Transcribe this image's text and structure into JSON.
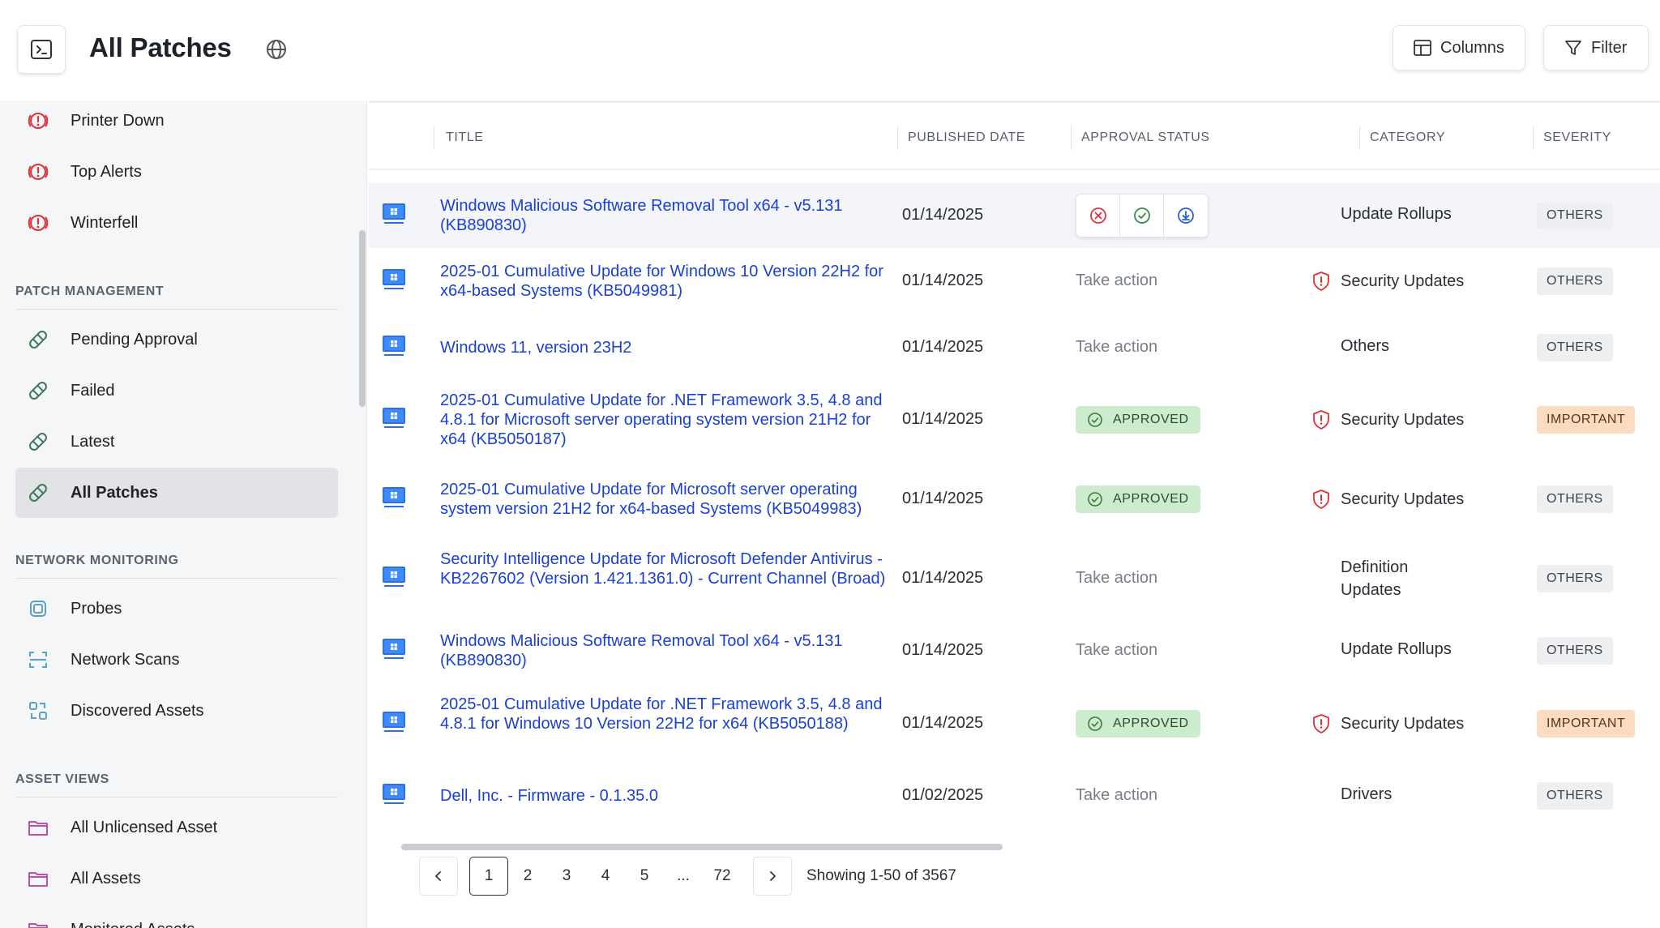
{
  "header": {
    "title": "All Patches",
    "columns_label": "Columns",
    "filter_label": "Filter"
  },
  "sidebar": {
    "alerts": [
      {
        "label": "Printer Down",
        "icon": "alert-icon"
      },
      {
        "label": "Top Alerts",
        "icon": "alert-icon"
      },
      {
        "label": "Winterfell",
        "icon": "alert-icon"
      }
    ],
    "patch_section": "PATCH MANAGEMENT",
    "patch_items": [
      {
        "label": "Pending Approval",
        "icon": "bandage-icon"
      },
      {
        "label": "Failed",
        "icon": "bandage-icon"
      },
      {
        "label": "Latest",
        "icon": "bandage-icon"
      },
      {
        "label": "All Patches",
        "icon": "bandage-icon",
        "active": true
      }
    ],
    "network_section": "NETWORK MONITORING",
    "network_items": [
      {
        "label": "Probes",
        "icon": "chip-icon"
      },
      {
        "label": "Network Scans",
        "icon": "scan-icon"
      },
      {
        "label": "Discovered Assets",
        "icon": "discover-icon"
      }
    ],
    "asset_section": "ASSET VIEWS",
    "asset_items": [
      {
        "label": "All Unlicensed Asset",
        "icon": "folder-icon"
      },
      {
        "label": "All Assets",
        "icon": "folder-icon"
      },
      {
        "label": "Monitored Assets",
        "icon": "folder-icon"
      }
    ]
  },
  "table": {
    "columns": [
      "TITLE",
      "PUBLISHED DATE",
      "APPROVAL STATUS",
      "CATEGORY",
      "SEVERITY"
    ],
    "rows": [
      {
        "title": "Windows Malicious Software Removal Tool x64 - v5.131 (KB890830)",
        "date": "01/14/2025",
        "status": "actions",
        "category": "Update Rollups",
        "security": false,
        "severity": "OTHERS"
      },
      {
        "title": "2025-01 Cumulative Update for Windows 10 Version 22H2 for x64-based Systems (KB5049981)",
        "date": "01/14/2025",
        "status": "Take action",
        "category": "Security Updates",
        "security": true,
        "severity": "OTHERS"
      },
      {
        "title": "Windows 11, version 23H2",
        "date": "01/14/2025",
        "status": "Take action",
        "category": "Others",
        "security": false,
        "severity": "OTHERS"
      },
      {
        "title": "2025-01 Cumulative Update for .NET Framework 3.5, 4.8 and 4.8.1 for Microsoft server operating system version 21H2 for x64 (KB5050187)",
        "date": "01/14/2025",
        "status": "APPROVED",
        "category": "Security Updates",
        "security": true,
        "severity": "IMPORTANT"
      },
      {
        "title": "2025-01 Cumulative Update for Microsoft server operating system version 21H2 for x64-based Systems (KB5049983)",
        "date": "01/14/2025",
        "status": "APPROVED",
        "category": "Security Updates",
        "security": true,
        "severity": "OTHERS"
      },
      {
        "title": "Security Intelligence Update for Microsoft Defender Antivirus - KB2267602 (Version 1.421.1361.0) - Current Channel (Broad)",
        "date": "01/14/2025",
        "status": "Take action",
        "category": "Definition Updates",
        "security": false,
        "severity": "OTHERS"
      },
      {
        "title": "Windows Malicious Software Removal Tool x64 - v5.131 (KB890830)",
        "date": "01/14/2025",
        "status": "Take action",
        "category": "Update Rollups",
        "security": false,
        "severity": "OTHERS"
      },
      {
        "title": "2025-01 Cumulative Update for .NET Framework 3.5, 4.8 and 4.8.1 for Windows 10 Version 22H2 for x64 (KB5050188)",
        "date": "01/14/2025",
        "status": "APPROVED",
        "category": "Security Updates",
        "security": true,
        "severity": "IMPORTANT"
      },
      {
        "title": "Dell, Inc. - Firmware - 0.1.35.0",
        "date": "01/02/2025",
        "status": "Take action",
        "category": "Drivers",
        "security": false,
        "severity": "OTHERS"
      }
    ]
  },
  "pagination": {
    "pages": [
      "1",
      "2",
      "3",
      "4",
      "5",
      "...",
      "72"
    ],
    "current": "1",
    "status": "Showing 1-50 of 3567"
  },
  "colors": {
    "link": "#1a3fd6",
    "alert": "#e0313a",
    "approved_bg": "#cdeccd",
    "important_bg": "#fbdcc1"
  }
}
